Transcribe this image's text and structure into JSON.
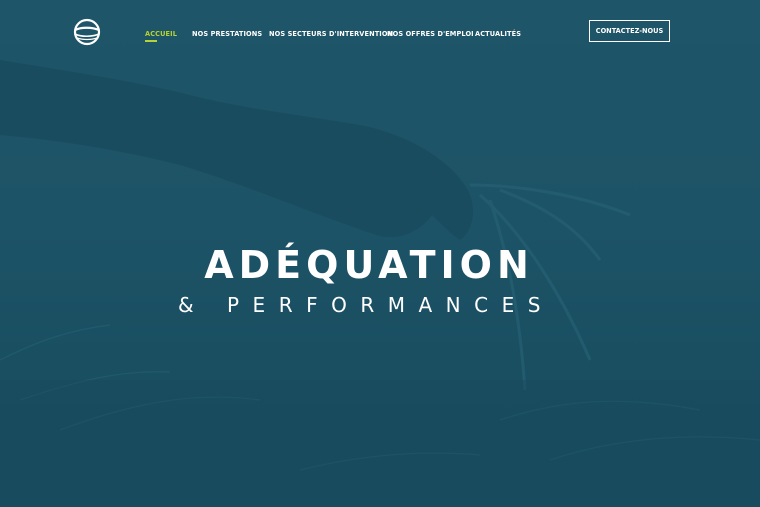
{
  "nav": {
    "items": [
      {
        "label": "ACCUEIL",
        "active": true
      },
      {
        "label": "NOS PRESTATIONS",
        "active": false
      },
      {
        "label": "NOS SECTEURS D'INTERVENTION",
        "active": false
      },
      {
        "label": "NOS OFFRES D'EMPLOI",
        "active": false
      },
      {
        "label": "ACTUALITÉS",
        "active": false
      }
    ],
    "contact_label": "CONTACTEZ-NOUS"
  },
  "hero": {
    "title": "ADÉQUATION",
    "subtitle": "& PERFORMANCES"
  },
  "colors": {
    "background": "#1d5366",
    "accent": "#b5d334",
    "text": "#ffffff"
  },
  "icons": {
    "logo": "globe-swoosh-logo-icon"
  }
}
